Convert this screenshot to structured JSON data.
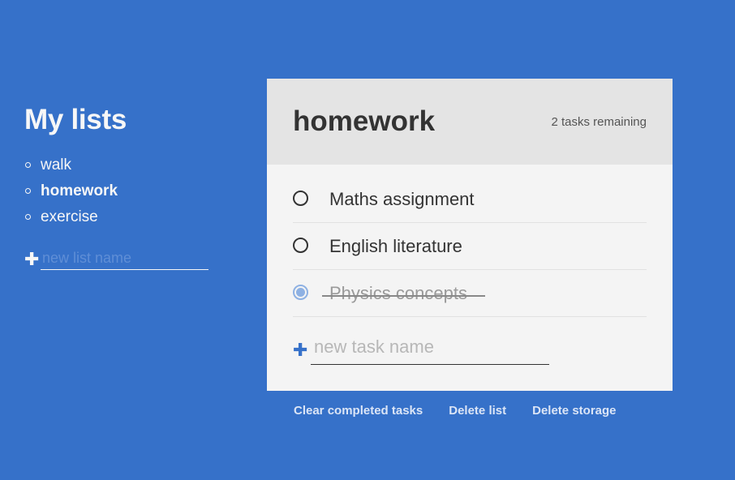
{
  "sidebar": {
    "title": "My lists",
    "lists": [
      {
        "name": "walk",
        "active": false
      },
      {
        "name": "homework",
        "active": true
      },
      {
        "name": "exercise",
        "active": false
      }
    ],
    "new_list_placeholder": "new list name",
    "add_icon": "plus-icon"
  },
  "todo": {
    "title": "homework",
    "remaining": "2 tasks remaining",
    "tasks": [
      {
        "label": "Maths assignment",
        "completed": false
      },
      {
        "label": "English literature",
        "completed": false
      },
      {
        "label": "Physics concepts",
        "completed": true
      }
    ],
    "new_task_placeholder": "new task name",
    "add_icon": "plus-icon"
  },
  "footer": {
    "clear_label": "Clear completed tasks",
    "delete_list_label": "Delete list",
    "delete_storage_label": "Delete storage"
  },
  "colors": {
    "background": "#3671c9",
    "card": "#f4f4f4",
    "card_header": "#e4e4e4",
    "checked": "#8eb1e3"
  }
}
